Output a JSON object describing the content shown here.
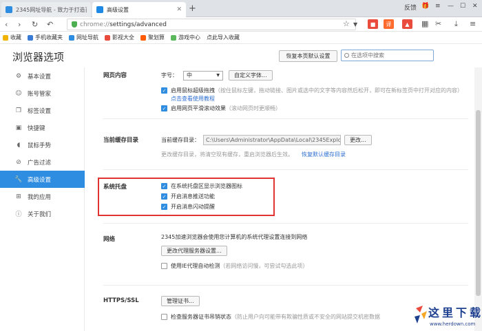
{
  "tabs": [
    {
      "title": "2345网址导航 - 致力于打造百",
      "active": false
    },
    {
      "title": "高级设置",
      "active": true
    }
  ],
  "titlebar": {
    "feedback": "反馈"
  },
  "address": {
    "scheme": "chrome://",
    "path": "settings/advanced"
  },
  "bookmarks": [
    {
      "label": "收藏",
      "color": "#f0b400"
    },
    {
      "label": "手机收藏夹",
      "color": "#3a7bd5"
    },
    {
      "label": "网址导航",
      "color": "#2e8de0"
    },
    {
      "label": "影视大全",
      "color": "#e94b3c"
    },
    {
      "label": "聚划算",
      "color": "#ff5a00"
    },
    {
      "label": "游戏中心",
      "color": "#5cb85c"
    },
    {
      "label": "点此导入收藏",
      "color": "#ffffff"
    }
  ],
  "header": {
    "title": "浏览器选项",
    "restore_label": "恢复本页默认设置",
    "search_placeholder": "在选项中搜索"
  },
  "sidebar": {
    "items": [
      {
        "label": "基本设置",
        "icon": "gear-icon",
        "active": false
      },
      {
        "label": "账号管家",
        "icon": "account-icon",
        "active": false
      },
      {
        "label": "标签设置",
        "icon": "tab-icon",
        "active": false
      },
      {
        "label": "快捷键",
        "icon": "keyboard-icon",
        "active": false
      },
      {
        "label": "鼠标手势",
        "icon": "mouse-icon",
        "active": false
      },
      {
        "label": "广告过滤",
        "icon": "block-icon",
        "active": false
      },
      {
        "label": "高级设置",
        "icon": "wrench-icon",
        "active": true
      },
      {
        "label": "我的应用",
        "icon": "apps-icon",
        "active": false
      },
      {
        "label": "关于我们",
        "icon": "info-icon",
        "active": false
      }
    ]
  },
  "content": {
    "web": {
      "title": "网页内容",
      "font_size_label": "字号：",
      "font_size_value": "中",
      "custom_font_button": "自定义字体...",
      "drag_label": "启用鼠标超级拖拽",
      "drag_hint": "（按住鼠标左键，拖动链接、图片或选中的文字等内容然后松开，即可在新标签页中打开对应的内容）",
      "drag_link": "点击查看使用教程",
      "smooth_label": "启用网页平滑滚动效果",
      "smooth_hint": "（滚动网页时更顺畅）"
    },
    "cache": {
      "title": "当前缓存目录",
      "dir_label": "当前缓存目录：",
      "dir_value": "C:\\Users\\Administrator\\AppData\\Local\\2345Explorer\\",
      "change_button": "更改...",
      "hint": "更改缓存目录，将清空现有缓存，重启浏览器后生效。",
      "restore_link": "恢复默认缓存目录"
    },
    "tray": {
      "title": "系统托盘",
      "items": [
        "在系统托盘区显示浏览器图标",
        "开启消息推送功能",
        "开启消息闪动提醒"
      ]
    },
    "network": {
      "title": "网络",
      "desc": "2345加速浏览器会使用您计算机的系统代理设置连接到网络",
      "proxy_button": "更改代理服务器设置...",
      "ie_proxy_label": "使用IE代理自动检测",
      "ie_proxy_hint": "（若网络访问慢，可尝试勾选此项）"
    },
    "https": {
      "title": "HTTPS/SSL",
      "cert_button": "管理证书...",
      "revoke_label": "检查服务器证书吊销状态",
      "revoke_hint": "（防止用户向可能带有欺骗性质或不安全的网站提交机密数据"
    }
  },
  "watermark": {
    "text": "这里下载",
    "url": "www.herdown.com"
  }
}
